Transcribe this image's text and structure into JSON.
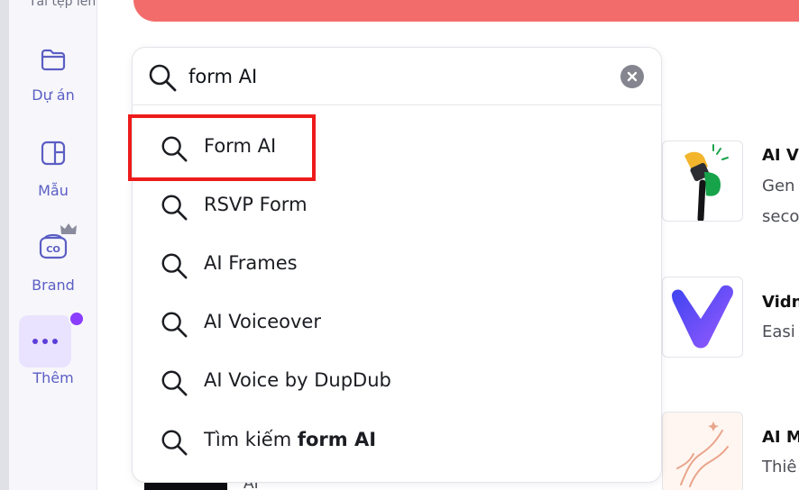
{
  "sidebar": {
    "top_label": "Tải tệp lên",
    "items": [
      {
        "label": "Dự án",
        "icon": "folder-icon"
      },
      {
        "label": "Mẫu",
        "icon": "template-icon"
      },
      {
        "label": "Brand",
        "icon": "brand-kit-icon",
        "badge": "crown-icon"
      },
      {
        "label": "Thêm",
        "icon": "more-icon",
        "notification": true
      }
    ]
  },
  "search": {
    "value": "form AI",
    "placeholder": "",
    "suggestions": [
      {
        "label": "Form AI"
      },
      {
        "label": "RSVP Form"
      },
      {
        "label": "AI Frames"
      },
      {
        "label": "AI Voiceover"
      },
      {
        "label": "AI Voice by DupDub"
      },
      {
        "label_prefix": "Tìm kiếm ",
        "label_bold": "form AI"
      }
    ]
  },
  "cards": [
    {
      "title": "AI V",
      "desc_line1": "Gen",
      "desc_line2": "seco",
      "icon": "microphone-icon"
    },
    {
      "title": "Vidn",
      "desc_line1": "Easi",
      "icon": "vidnoz-logo-icon"
    },
    {
      "title": "AI M",
      "desc_line1": "Thiê",
      "icon": "hand-art-icon"
    }
  ],
  "bottom": {
    "text": "AI"
  },
  "colors": {
    "banner": "#f36c6c",
    "accent": "#8b3dff",
    "sidebar_label": "#5b5ec4",
    "highlight": "#ee1b1b"
  }
}
